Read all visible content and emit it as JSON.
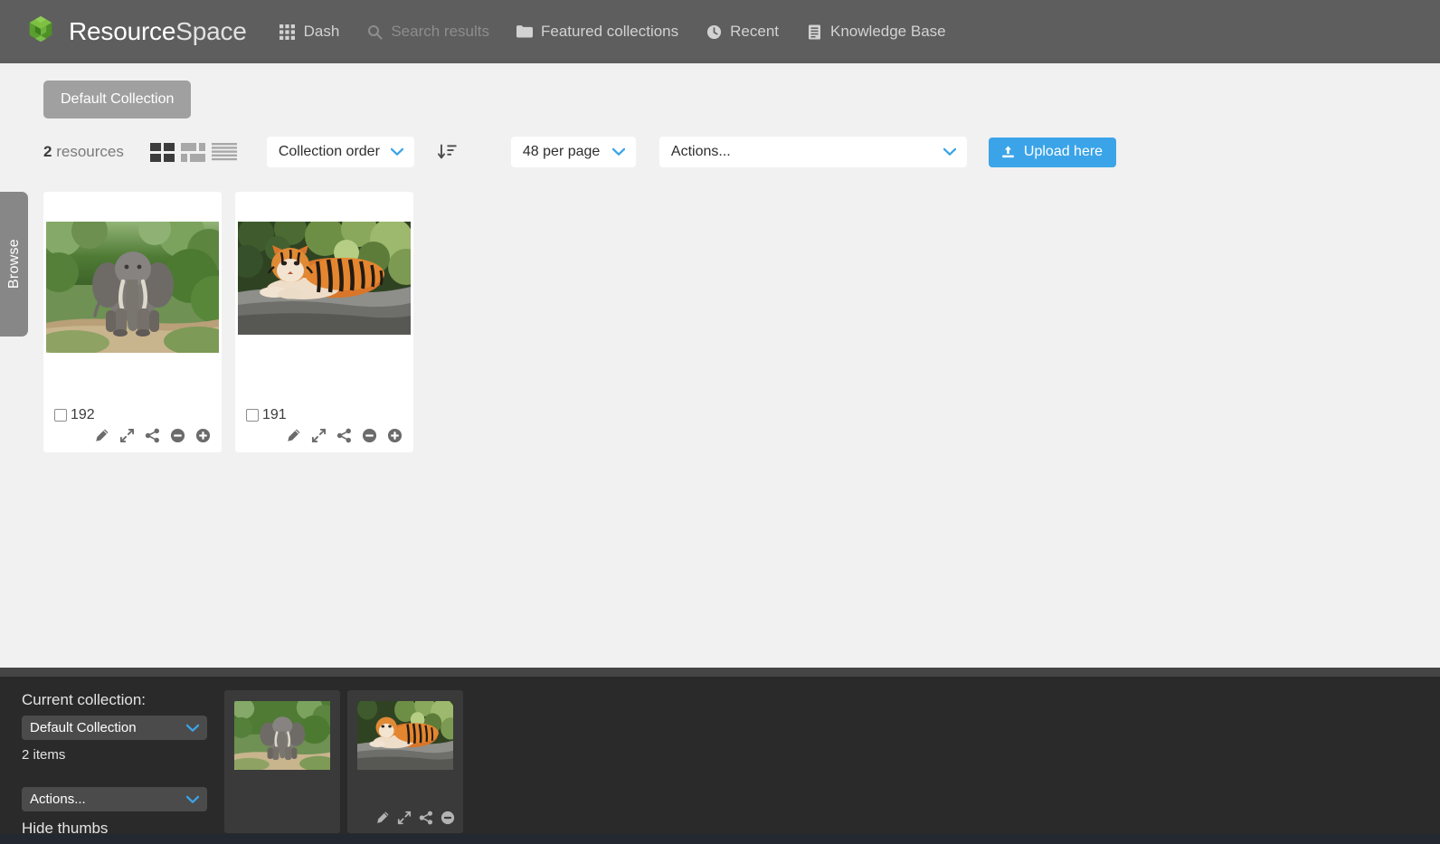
{
  "header": {
    "logo_icon": "resourcespace-cube-logo",
    "brand_strong": "Resource",
    "brand_light": "Space",
    "nav": [
      {
        "label": "Dash",
        "icon": "grid-apps-icon",
        "dim": false
      },
      {
        "label": "Search results",
        "icon": "search-icon",
        "dim": true
      },
      {
        "label": "Featured collections",
        "icon": "folder-icon",
        "dim": false
      },
      {
        "label": "Recent",
        "icon": "clock-icon",
        "dim": false
      },
      {
        "label": "Knowledge Base",
        "icon": "book-icon",
        "dim": false
      }
    ]
  },
  "browse_tab": {
    "label": "Browse"
  },
  "main": {
    "collection_tab_label": "Default Collection",
    "resource_count_number": "2",
    "resource_count_label": "resources",
    "view_modes": [
      {
        "name": "large-grid-view",
        "active": true
      },
      {
        "name": "small-grid-view",
        "active": false
      },
      {
        "name": "list-view",
        "active": false
      }
    ],
    "sort_order_value": "Collection order",
    "sort_direction_icon": "sort-descending-icon",
    "per_page_value": "48 per page",
    "actions_value": "Actions...",
    "upload_label": "Upload here",
    "upload_icon": "upload-icon"
  },
  "resources": [
    {
      "id": "192",
      "subject": "elephant",
      "checked": false,
      "actions": [
        {
          "name": "edit-icon"
        },
        {
          "name": "expand-icon"
        },
        {
          "name": "share-icon"
        },
        {
          "name": "remove-from-collection-icon"
        },
        {
          "name": "add-to-collection-icon"
        }
      ]
    },
    {
      "id": "191",
      "subject": "tiger",
      "checked": false,
      "actions": [
        {
          "name": "edit-icon"
        },
        {
          "name": "expand-icon"
        },
        {
          "name": "share-icon"
        },
        {
          "name": "remove-from-collection-icon"
        },
        {
          "name": "add-to-collection-icon"
        }
      ]
    }
  ],
  "collection_bar": {
    "current_collection_label": "Current collection:",
    "current_collection_value": "Default Collection",
    "items_count_label": "2 items",
    "actions_value": "Actions...",
    "hide_thumbs_label": "Hide thumbs",
    "thumbs": [
      {
        "subject": "elephant",
        "show_actions": false
      },
      {
        "subject": "tiger",
        "show_actions": true
      }
    ],
    "thumb_actions": [
      {
        "name": "edit-icon"
      },
      {
        "name": "expand-icon"
      },
      {
        "name": "share-icon"
      },
      {
        "name": "remove-from-collection-icon"
      }
    ]
  },
  "colors": {
    "header_bg": "#5e5e5e",
    "page_bg": "#f1f1f1",
    "accent_blue": "#3ba4e8",
    "collection_tab": "#a0a0a0",
    "collbar_bg": "#2a2a2a",
    "collbar_top": "#454545",
    "logo_green": "#6cb33f"
  }
}
